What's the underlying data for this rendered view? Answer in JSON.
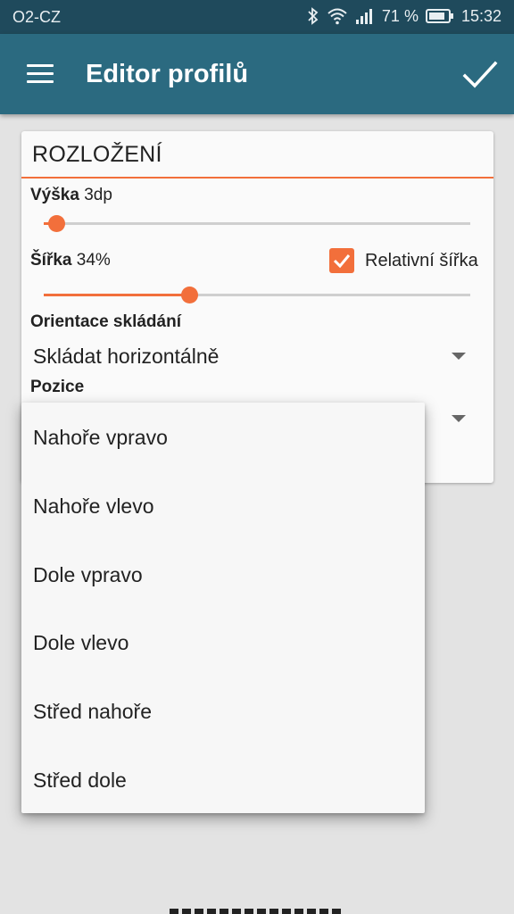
{
  "status_bar": {
    "carrier": "O2-CZ",
    "battery_percent": "71 %",
    "time": "15:32",
    "icons": [
      "bluetooth-icon",
      "wifi-icon",
      "signal-icon",
      "battery-icon"
    ]
  },
  "app_bar": {
    "title": "Editor profilů",
    "menu_icon": "hamburger-menu-icon",
    "confirm_icon": "check-icon"
  },
  "colors": {
    "accent": "#f26f3b",
    "app_bar": "#2b6a80",
    "status_bar": "#1f4a5c"
  },
  "layout_section": {
    "title": "ROZLOŽENÍ",
    "height": {
      "label": "Výška",
      "value": "3dp",
      "slider_fraction": 0.03
    },
    "width": {
      "label": "Šířka",
      "value": "34%",
      "slider_fraction": 0.34
    },
    "relative_width": {
      "label": "Relativní šířka",
      "checked": true
    },
    "stacking_orientation": {
      "label": "Orientace skládání",
      "value": "Skládat horizontálně"
    },
    "position": {
      "label": "Pozice"
    }
  },
  "position_menu": {
    "options": [
      "Nahoře vpravo",
      "Nahoře vlevo",
      "Dole vpravo",
      "Dole vlevo",
      "Střed nahoře",
      "Střed dole"
    ]
  }
}
